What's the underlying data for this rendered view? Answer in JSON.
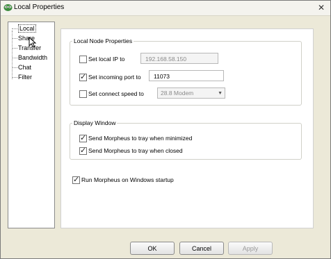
{
  "window": {
    "title": "Local Properties",
    "close_glyph": "✕"
  },
  "nav": {
    "items": [
      {
        "label": "Local",
        "selected": true
      },
      {
        "label": "Share",
        "selected": false
      },
      {
        "label": "Transfer",
        "selected": false
      },
      {
        "label": "Bandwidth",
        "selected": false
      },
      {
        "label": "Chat",
        "selected": false
      },
      {
        "label": "Filter",
        "selected": false
      }
    ]
  },
  "local_node": {
    "legend": "Local Node Properties",
    "local_ip": {
      "label": "Set local IP to",
      "checked": false,
      "value": "192.168.58.150"
    },
    "incoming_port": {
      "label": "Set incoming port to",
      "checked": true,
      "value": "11073"
    },
    "connect_speed": {
      "label": "Set connect speed to",
      "checked": false,
      "value": "28.8 Modem"
    }
  },
  "display_window": {
    "legend": "Display Window",
    "tray_minimized": {
      "label": "Send Morpheus to tray when minimized",
      "checked": true
    },
    "tray_closed": {
      "label": "Send Morpheus to tray when closed",
      "checked": true
    }
  },
  "startup": {
    "label": "Run Morpheus on Windows startup",
    "checked": true
  },
  "buttons": {
    "ok": "OK",
    "cancel": "Cancel",
    "apply": "Apply"
  },
  "icons": {
    "app": "morpheus-app-icon",
    "close": "close-icon",
    "cursor": "mouse-pointer-icon",
    "dropdown": "chevron-down-icon"
  }
}
